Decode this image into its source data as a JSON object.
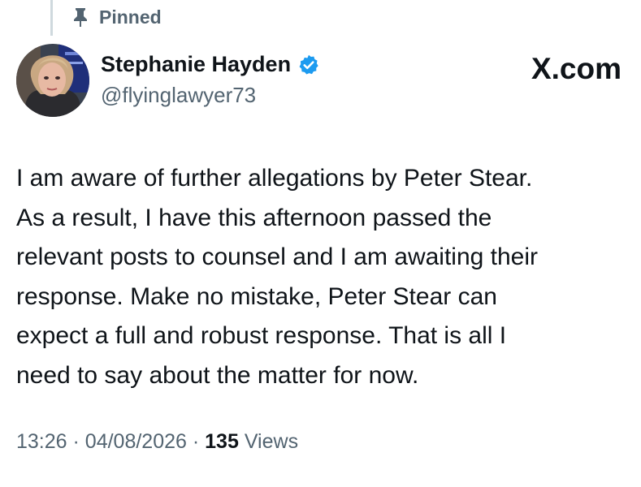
{
  "pinned": {
    "icon": "pin-icon",
    "label": "Pinned"
  },
  "author": {
    "name": "Stephanie Hayden",
    "handle": "@flyinglawyer73",
    "verified_icon": "verified-badge-icon",
    "verified_color": "#1d9bf0"
  },
  "site_label": "X.com",
  "tweet": {
    "lines": [
      "I am aware of further allegations by Peter Stear.",
      "As a result, I have this afternoon passed the",
      "relevant posts to counsel and I am awaiting their",
      "response. Make no mistake, Peter Stear can",
      "expect a full and robust response. That is all I",
      "need to say about the matter for now."
    ]
  },
  "meta": {
    "time": "13:26",
    "separator": "·",
    "date": "04/08/2026",
    "views_count": "135",
    "views_label": "Views"
  },
  "colors": {
    "text_primary": "#0f1419",
    "text_secondary": "#536471",
    "thread_line": "#cfd9de"
  }
}
